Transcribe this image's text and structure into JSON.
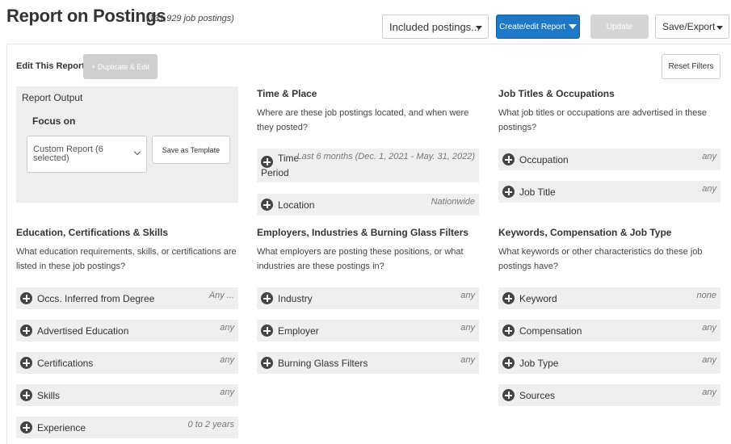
{
  "header": {
    "title": "Report on Postings",
    "subtitle": "(131,929 job postings)",
    "included_select": "Included postings...",
    "create_btn": "Create/edit Report",
    "update_btn": "Update",
    "save_export": "Save/Export"
  },
  "toolbar": {
    "edit_label": "Edit This Report",
    "duplicate_btn": "+ Duplicate & Edit",
    "reset_btn": "Reset Filters"
  },
  "output": {
    "title": "Report Output",
    "focus_label": "Focus on",
    "focus_value": "Custom Report (6 selected)",
    "template_btn": "Save as Template"
  },
  "sections": {
    "time_place": {
      "title": "Time & Place",
      "desc": "Where are these job postings located, and when were they posted?",
      "time_label": "Time",
      "time_label_2": "Period",
      "time_value": "Last 6 months (Dec. 1, 2021 - May. 31, 2022)",
      "location_label": "Location",
      "location_value": "Nationwide"
    },
    "titles": {
      "title": "Job Titles & Occupations",
      "desc": "What job titles or occupations are advertised in these postings?",
      "occupation_label": "Occupation",
      "occupation_value": "any",
      "jobtitle_label": "Job Title",
      "jobtitle_value": "any"
    },
    "education": {
      "title": "Education, Certifications & Skills",
      "desc": "What education requirements, skills, or certifications are listed in these job postings?",
      "items": [
        {
          "label": "Occs. Inferred from Degree",
          "value": "Any ..."
        },
        {
          "label": "Advertised Education",
          "value": "any"
        },
        {
          "label": "Certifications",
          "value": "any"
        },
        {
          "label": "Skills",
          "value": "any"
        },
        {
          "label": "Experience",
          "value": "0 to 2 years"
        }
      ]
    },
    "employers": {
      "title": "Employers, Industries & Burning Glass Filters",
      "desc": "What employers are posting these positions, or what industries are these postings in?",
      "items": [
        {
          "label": "Industry",
          "value": "any"
        },
        {
          "label": "Employer",
          "value": "any"
        },
        {
          "label": "Burning Glass Filters",
          "value": "any"
        }
      ]
    },
    "keywords": {
      "title": "Keywords, Compensation & Job Type",
      "desc": "What keywords or other characteristics do these job postings have?",
      "items": [
        {
          "label": "Keyword",
          "value": "none"
        },
        {
          "label": "Compensation",
          "value": "any"
        },
        {
          "label": "Job Type",
          "value": "any"
        },
        {
          "label": "Sources",
          "value": "any"
        }
      ]
    }
  },
  "colors": {
    "primary": "#1e78c8",
    "disabled": "#cfcfcf",
    "filter_bg": "#efefef",
    "output_bg": "#eeeeee"
  },
  "icons": {
    "filter_add": "plus-circle-icon",
    "dropdown": "caret-down-icon"
  }
}
